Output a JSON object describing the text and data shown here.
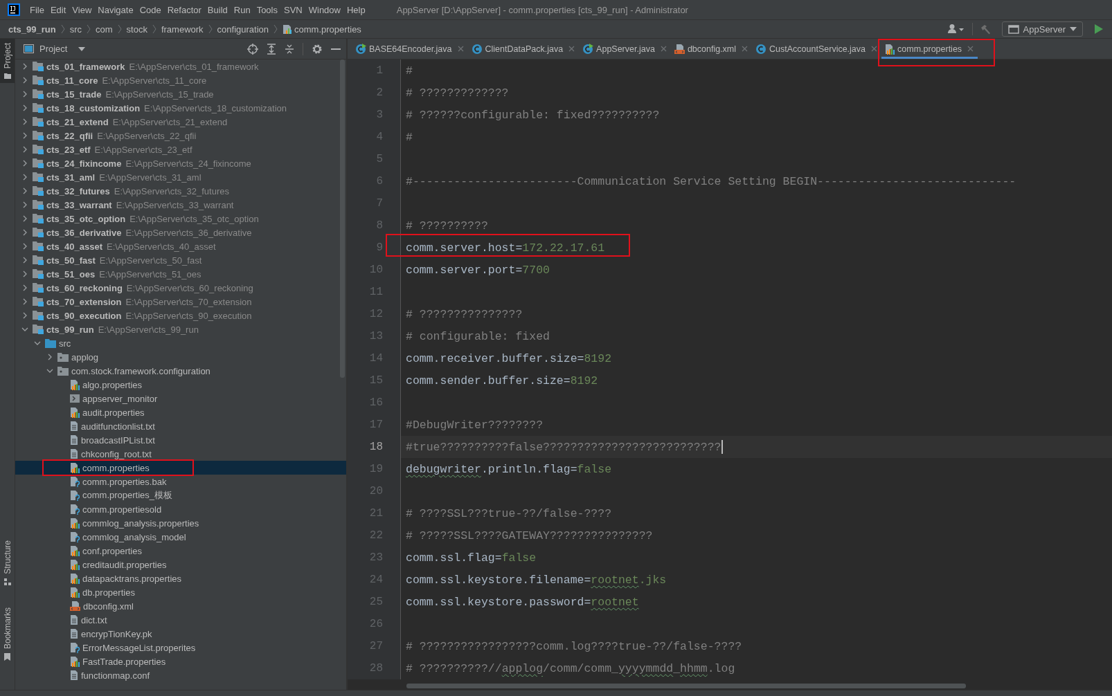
{
  "window": {
    "title": "AppServer [D:\\AppServer] - comm.properties [cts_99_run] - Administrator"
  },
  "menu": [
    "File",
    "Edit",
    "View",
    "Navigate",
    "Code",
    "Refactor",
    "Build",
    "Run",
    "Tools",
    "SVN",
    "Window",
    "Help"
  ],
  "breadcrumbs": [
    {
      "label": "cts_99_run",
      "kind": "module"
    },
    {
      "label": "src",
      "kind": "folder"
    },
    {
      "label": "com",
      "kind": "folder"
    },
    {
      "label": "stock",
      "kind": "folder"
    },
    {
      "label": "framework",
      "kind": "folder"
    },
    {
      "label": "configuration",
      "kind": "folder"
    },
    {
      "label": "comm.properties",
      "kind": "file"
    }
  ],
  "toolbar": {
    "run_configuration": "AppServer"
  },
  "side_tabs": [
    {
      "label": "Project",
      "kind": "top",
      "selected": true
    },
    {
      "label": "Structure",
      "kind": "bottom",
      "selected": false
    },
    {
      "label": "Bookmarks",
      "kind": "bottom",
      "selected": false
    }
  ],
  "project_panel": {
    "title": "Project",
    "tree": [
      {
        "name": "cts_01_framework",
        "path": "E:\\AppServer\\cts_01_framework",
        "kind": "module",
        "expanded": false,
        "selected": false,
        "annotated": false
      },
      {
        "name": "cts_11_core",
        "path": "E:\\AppServer\\cts_11_core",
        "kind": "module",
        "expanded": false,
        "selected": false,
        "annotated": false
      },
      {
        "name": "cts_15_trade",
        "path": "E:\\AppServer\\cts_15_trade",
        "kind": "module",
        "expanded": false,
        "selected": false,
        "annotated": false
      },
      {
        "name": "cts_18_customization",
        "path": "E:\\AppServer\\cts_18_customization",
        "kind": "module",
        "expanded": false,
        "selected": false,
        "annotated": false
      },
      {
        "name": "cts_21_extend",
        "path": "E:\\AppServer\\cts_21_extend",
        "kind": "module",
        "expanded": false,
        "selected": false,
        "annotated": false
      },
      {
        "name": "cts_22_qfii",
        "path": "E:\\AppServer\\cts_22_qfii",
        "kind": "module",
        "expanded": false,
        "selected": false,
        "annotated": false
      },
      {
        "name": "cts_23_etf",
        "path": "E:\\AppServer\\cts_23_etf",
        "kind": "module",
        "expanded": false,
        "selected": false,
        "annotated": false
      },
      {
        "name": "cts_24_fixincome",
        "path": "E:\\AppServer\\cts_24_fixincome",
        "kind": "module",
        "expanded": false,
        "selected": false,
        "annotated": false
      },
      {
        "name": "cts_31_aml",
        "path": "E:\\AppServer\\cts_31_aml",
        "kind": "module",
        "expanded": false,
        "selected": false,
        "annotated": false
      },
      {
        "name": "cts_32_futures",
        "path": "E:\\AppServer\\cts_32_futures",
        "kind": "module",
        "expanded": false,
        "selected": false,
        "annotated": false
      },
      {
        "name": "cts_33_warrant",
        "path": "E:\\AppServer\\cts_33_warrant",
        "kind": "module",
        "expanded": false,
        "selected": false,
        "annotated": false
      },
      {
        "name": "cts_35_otc_option",
        "path": "E:\\AppServer\\cts_35_otc_option",
        "kind": "module",
        "expanded": false,
        "selected": false,
        "annotated": false
      },
      {
        "name": "cts_36_derivative",
        "path": "E:\\AppServer\\cts_36_derivative",
        "kind": "module",
        "expanded": false,
        "selected": false,
        "annotated": false
      },
      {
        "name": "cts_40_asset",
        "path": "E:\\AppServer\\cts_40_asset",
        "kind": "module",
        "expanded": false,
        "selected": false,
        "annotated": false
      },
      {
        "name": "cts_50_fast",
        "path": "E:\\AppServer\\cts_50_fast",
        "kind": "module",
        "expanded": false,
        "selected": false,
        "annotated": false
      },
      {
        "name": "cts_51_oes",
        "path": "E:\\AppServer\\cts_51_oes",
        "kind": "module",
        "expanded": false,
        "selected": false,
        "annotated": false
      },
      {
        "name": "cts_60_reckoning",
        "path": "E:\\AppServer\\cts_60_reckoning",
        "kind": "module",
        "expanded": false,
        "selected": false,
        "annotated": false
      },
      {
        "name": "cts_70_extension",
        "path": "E:\\AppServer\\cts_70_extension",
        "kind": "module",
        "expanded": false,
        "selected": false,
        "annotated": false
      },
      {
        "name": "cts_90_execution",
        "path": "E:\\AppServer\\cts_90_execution",
        "kind": "module",
        "expanded": false,
        "selected": false,
        "annotated": false
      },
      {
        "name": "cts_99_run",
        "path": "E:\\AppServer\\cts_99_run",
        "kind": "module",
        "expanded": true,
        "selected": false,
        "annotated": false,
        "children": [
          {
            "name": "src",
            "kind": "source_folder",
            "expanded": true,
            "selected": false,
            "annotated": false,
            "children": [
              {
                "name": "applog",
                "kind": "package",
                "expanded": false,
                "selected": false,
                "annotated": false
              },
              {
                "name": "com.stock.framework.configuration",
                "kind": "package",
                "expanded": true,
                "selected": false,
                "annotated": false,
                "children": [
                  {
                    "name": "algo.properties",
                    "kind": "properties",
                    "selected": false,
                    "annotated": false
                  },
                  {
                    "name": "appserver_monitor",
                    "kind": "executable",
                    "selected": false,
                    "annotated": false
                  },
                  {
                    "name": "audit.properties",
                    "kind": "properties",
                    "selected": false,
                    "annotated": false
                  },
                  {
                    "name": "auditfunctionlist.txt",
                    "kind": "text",
                    "selected": false,
                    "annotated": false
                  },
                  {
                    "name": "broadcastIPList.txt",
                    "kind": "text",
                    "selected": false,
                    "annotated": false
                  },
                  {
                    "name": "chkconfig_root.txt",
                    "kind": "text",
                    "selected": false,
                    "annotated": false
                  },
                  {
                    "name": "comm.properties",
                    "kind": "properties",
                    "selected": true,
                    "annotated": true
                  },
                  {
                    "name": "comm.properties.bak",
                    "kind": "unknown",
                    "selected": false,
                    "annotated": false
                  },
                  {
                    "name": "comm.properties_模板",
                    "kind": "unknown",
                    "selected": false,
                    "annotated": false
                  },
                  {
                    "name": "comm.propertiesold",
                    "kind": "unknown",
                    "selected": false,
                    "annotated": false
                  },
                  {
                    "name": "commlog_analysis.properties",
                    "kind": "properties",
                    "selected": false,
                    "annotated": false
                  },
                  {
                    "name": "commlog_analysis_model",
                    "kind": "unknown",
                    "selected": false,
                    "annotated": false
                  },
                  {
                    "name": "conf.properties",
                    "kind": "properties",
                    "selected": false,
                    "annotated": false
                  },
                  {
                    "name": "creditaudit.properties",
                    "kind": "properties",
                    "selected": false,
                    "annotated": false
                  },
                  {
                    "name": "datapacktrans.properties",
                    "kind": "properties",
                    "selected": false,
                    "annotated": false
                  },
                  {
                    "name": "db.properties",
                    "kind": "properties",
                    "selected": false,
                    "annotated": false
                  },
                  {
                    "name": "dbconfig.xml",
                    "kind": "xml",
                    "selected": false,
                    "annotated": false
                  },
                  {
                    "name": "dict.txt",
                    "kind": "text",
                    "selected": false,
                    "annotated": false
                  },
                  {
                    "name": "encrypTionKey.pk",
                    "kind": "text",
                    "selected": false,
                    "annotated": false
                  },
                  {
                    "name": "ErrorMessageList.properites",
                    "kind": "unknown",
                    "selected": false,
                    "annotated": false
                  },
                  {
                    "name": "FastTrade.properties",
                    "kind": "properties",
                    "selected": false,
                    "annotated": false
                  },
                  {
                    "name": "functionmap.conf",
                    "kind": "text",
                    "selected": false,
                    "annotated": false
                  }
                ]
              }
            ]
          }
        ]
      }
    ]
  },
  "tabs": [
    {
      "label": "BASE64Encoder.java",
      "kind": "java_run",
      "selected": false,
      "annotated": false
    },
    {
      "label": "ClientDataPack.java",
      "kind": "java_class",
      "selected": false,
      "annotated": false
    },
    {
      "label": "AppServer.java",
      "kind": "java_run",
      "selected": false,
      "annotated": false
    },
    {
      "label": "dbconfig.xml",
      "kind": "xml",
      "selected": false,
      "annotated": false
    },
    {
      "label": "CustAccountService.java",
      "kind": "java_class",
      "selected": false,
      "annotated": false
    },
    {
      "label": "comm.properties",
      "kind": "properties",
      "selected": true,
      "annotated": true
    }
  ],
  "editor": {
    "lines": [
      {
        "number": "1",
        "current": false,
        "annotated": false,
        "segments": [
          {
            "text": "#",
            "kind": "comment"
          }
        ]
      },
      {
        "number": "2",
        "current": false,
        "annotated": false,
        "segments": [
          {
            "text": "# ?????????????",
            "kind": "comment"
          }
        ]
      },
      {
        "number": "3",
        "current": false,
        "annotated": false,
        "segments": [
          {
            "text": "# ??????configurable: fixed??????????",
            "kind": "comment"
          }
        ]
      },
      {
        "number": "4",
        "current": false,
        "annotated": false,
        "segments": [
          {
            "text": "#",
            "kind": "comment"
          }
        ]
      },
      {
        "number": "5",
        "current": false,
        "annotated": false
      },
      {
        "number": "6",
        "current": false,
        "annotated": false,
        "segments": [
          {
            "text": "#------------------------Communication Service Setting BEGIN-----------------------------",
            "kind": "comment"
          }
        ]
      },
      {
        "number": "7",
        "current": false,
        "annotated": false
      },
      {
        "number": "8",
        "current": false,
        "annotated": false,
        "segments": [
          {
            "text": "# ??????????",
            "kind": "comment"
          }
        ]
      },
      {
        "number": "9",
        "current": false,
        "annotated": true,
        "segments": [
          {
            "text": "comm.server.host=",
            "kind": "key"
          },
          {
            "text": "172.22.17.61",
            "kind": "value"
          }
        ]
      },
      {
        "number": "10",
        "current": false,
        "annotated": false,
        "segments": [
          {
            "text": "comm.server.port=",
            "kind": "key"
          },
          {
            "text": "7700",
            "kind": "value"
          }
        ]
      },
      {
        "number": "11",
        "current": false,
        "annotated": false
      },
      {
        "number": "12",
        "current": false,
        "annotated": false,
        "segments": [
          {
            "text": "# ???????????????",
            "kind": "comment"
          }
        ]
      },
      {
        "number": "13",
        "current": false,
        "annotated": false,
        "segments": [
          {
            "text": "# configurable: fixed",
            "kind": "comment"
          }
        ]
      },
      {
        "number": "14",
        "current": false,
        "annotated": false,
        "segments": [
          {
            "text": "comm.receiver.buffer.size=",
            "kind": "key"
          },
          {
            "text": "8192",
            "kind": "value"
          }
        ]
      },
      {
        "number": "15",
        "current": false,
        "annotated": false,
        "segments": [
          {
            "text": "comm.sender.buffer.size=",
            "kind": "key"
          },
          {
            "text": "8192",
            "kind": "value"
          }
        ]
      },
      {
        "number": "16",
        "current": false,
        "annotated": false
      },
      {
        "number": "17",
        "current": false,
        "annotated": false,
        "segments": [
          {
            "text": "#DebugWriter????????",
            "kind": "comment"
          }
        ]
      },
      {
        "number": "18",
        "current": true,
        "annotated": false,
        "segments": [
          {
            "text": "#true??????????false??????????????????????????",
            "kind": "comment"
          }
        ]
      },
      {
        "number": "19",
        "current": false,
        "annotated": false,
        "segments": [
          {
            "text": "debugwriter",
            "kind": "key_typo"
          },
          {
            "text": ".println.flag=",
            "kind": "key"
          },
          {
            "text": "false",
            "kind": "value"
          }
        ]
      },
      {
        "number": "20",
        "current": false,
        "annotated": false
      },
      {
        "number": "21",
        "current": false,
        "annotated": false,
        "segments": [
          {
            "text": "# ????SSL???true-??/false-????",
            "kind": "comment"
          }
        ]
      },
      {
        "number": "22",
        "current": false,
        "annotated": false,
        "segments": [
          {
            "text": "# ?????SSL????GATEWAY???????????????",
            "kind": "comment"
          }
        ]
      },
      {
        "number": "23",
        "current": false,
        "annotated": false,
        "segments": [
          {
            "text": "comm.ssl.flag=",
            "kind": "key"
          },
          {
            "text": "false",
            "kind": "value"
          }
        ]
      },
      {
        "number": "24",
        "current": false,
        "annotated": false,
        "segments": [
          {
            "text": "comm.ssl.keystore.filename=",
            "kind": "key"
          },
          {
            "text": "rootnet",
            "kind": "value_typo"
          },
          {
            "text": ".jks",
            "kind": "value"
          }
        ]
      },
      {
        "number": "25",
        "current": false,
        "annotated": false,
        "segments": [
          {
            "text": "comm.ssl.keystore.password=",
            "kind": "key"
          },
          {
            "text": "rootnet",
            "kind": "value_typo"
          }
        ]
      },
      {
        "number": "26",
        "current": false,
        "annotated": false
      },
      {
        "number": "27",
        "current": false,
        "annotated": false,
        "segments": [
          {
            "text": "# ?????????????????comm.log????true-??/false-????",
            "kind": "comment"
          }
        ]
      },
      {
        "number": "28",
        "current": false,
        "annotated": false,
        "segments": [
          {
            "text": "# ??????????//",
            "kind": "comment"
          },
          {
            "text": "applog",
            "kind": "comment_typo"
          },
          {
            "text": "/comm/comm_",
            "kind": "comment"
          },
          {
            "text": "yyyymmdd",
            "kind": "comment_typo"
          },
          {
            "text": "_",
            "kind": "comment"
          },
          {
            "text": "hhmm",
            "kind": "comment_typo"
          },
          {
            "text": ".log",
            "kind": "comment"
          }
        ]
      }
    ]
  }
}
